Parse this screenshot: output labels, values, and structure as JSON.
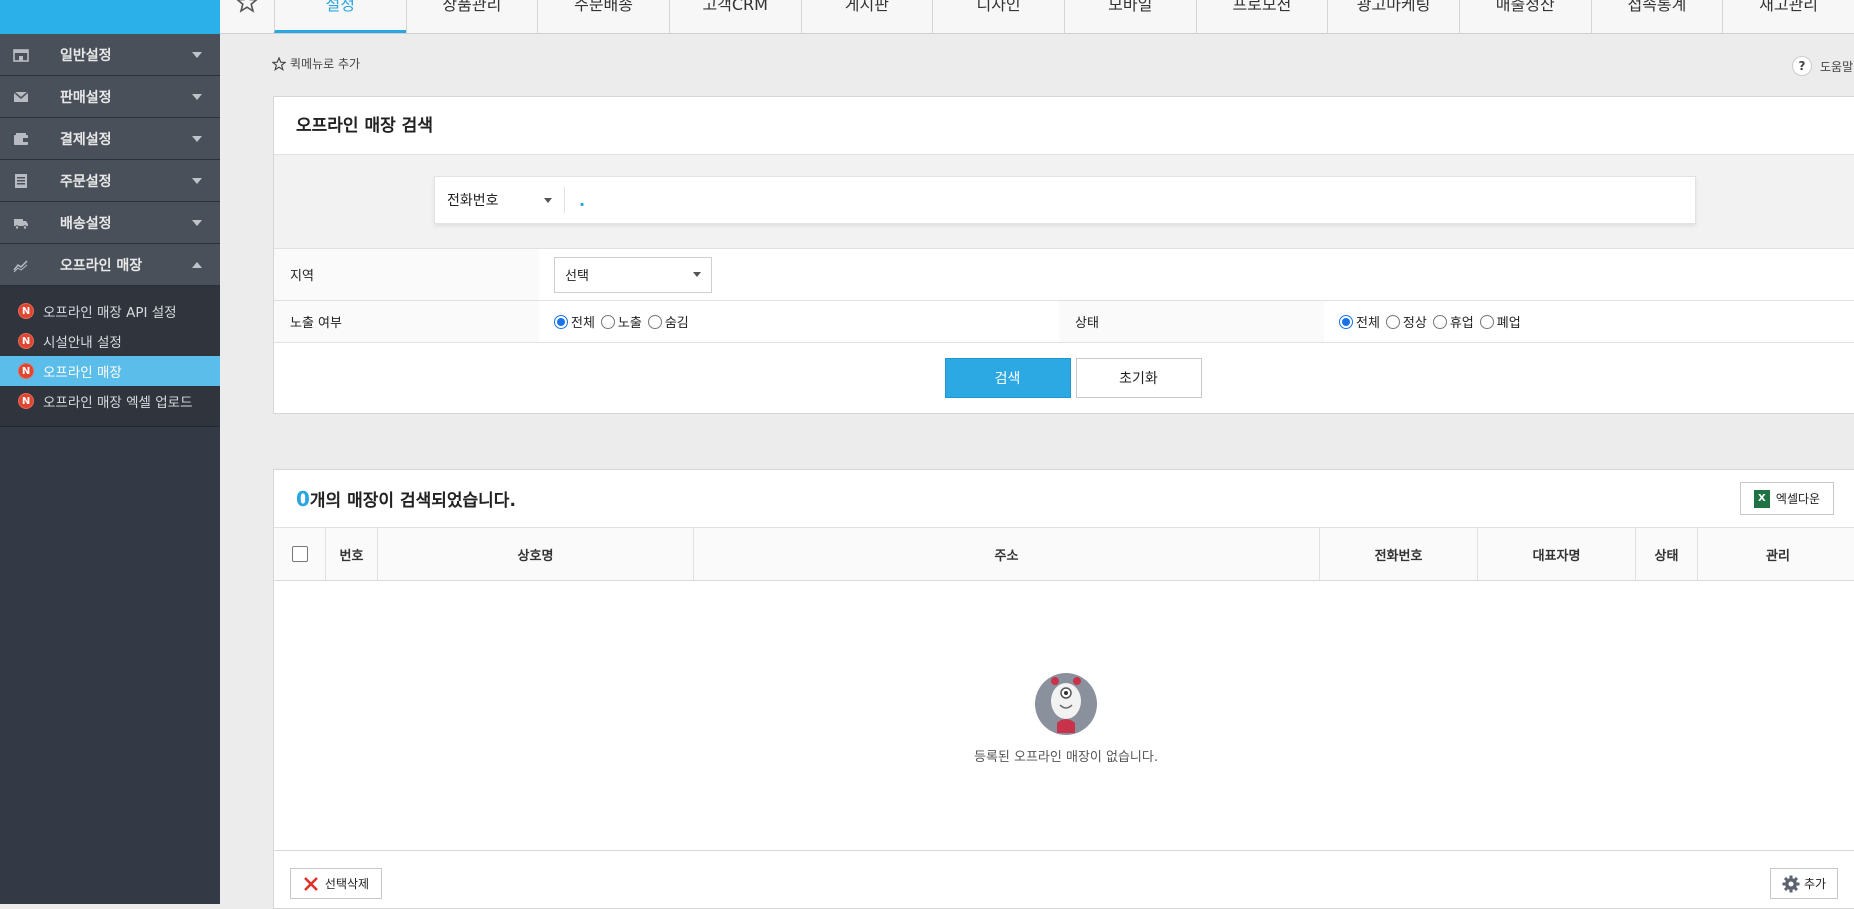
{
  "top_tabs": [
    "설정",
    "상품관리",
    "주문배송",
    "고객CRM",
    "게시판",
    "디자인",
    "모바일",
    "프로모션",
    "광고마케팅",
    "매출정산",
    "접속통계",
    "재고관리"
  ],
  "active_tab": "설정",
  "sidebar": {
    "items": [
      {
        "label": "일반설정",
        "icon": "store-icon"
      },
      {
        "label": "판매설정",
        "icon": "mail-icon"
      },
      {
        "label": "결제설정",
        "icon": "wallet-icon"
      },
      {
        "label": "주문설정",
        "icon": "document-icon"
      },
      {
        "label": "배송설정",
        "icon": "truck-icon"
      },
      {
        "label": "오프라인 매장",
        "icon": "chart-icon"
      }
    ],
    "submenu": [
      {
        "label": "오프라인 매장 API 설정",
        "badge": "N"
      },
      {
        "label": "시설안내 설정",
        "badge": "N"
      },
      {
        "label": "오프라인 매장",
        "badge": "N"
      },
      {
        "label": "오프라인 매장 엑셀 업로드",
        "badge": "N"
      }
    ]
  },
  "quick_menu_label": "퀵메뉴로 추가",
  "help_label": "도움말",
  "search_panel": {
    "title": "오프라인 매장 검색",
    "search_type": "전화번호",
    "search_value": ".",
    "region_label": "지역",
    "region_value": "선택",
    "exposure_label": "노출 여부",
    "exposure_options": [
      "전체",
      "노출",
      "숨김"
    ],
    "status_label": "상태",
    "status_options": [
      "전체",
      "정상",
      "휴업",
      "폐업"
    ],
    "search_button": "검색",
    "reset_button": "초기화"
  },
  "results": {
    "count": "0",
    "count_suffix": "개의 매장이 검색되었습니다.",
    "excel_button": "엑셀다운",
    "columns": [
      "번호",
      "상호명",
      "주소",
      "전화번호",
      "대표자명",
      "상태",
      "관리"
    ],
    "empty_message": "등록된 오프라인 매장이 없습니다.",
    "delete_button": "선택삭제",
    "add_button": "추가"
  }
}
